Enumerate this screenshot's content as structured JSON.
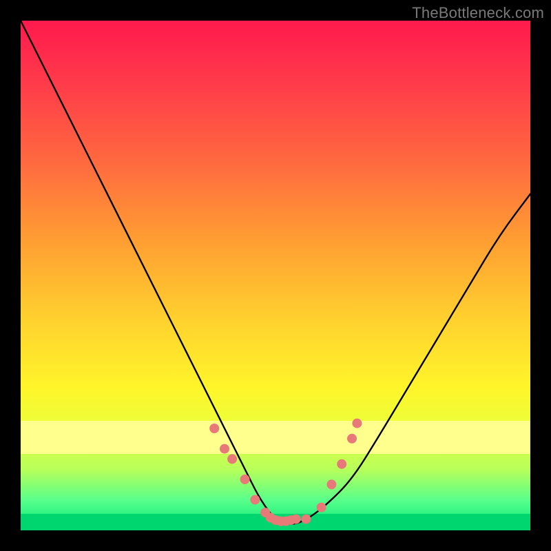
{
  "watermark": "TheBottleneck.com",
  "chart_data": {
    "type": "line",
    "title": "",
    "xlabel": "",
    "ylabel": "",
    "xlim": [
      0,
      100
    ],
    "ylim": [
      0,
      100
    ],
    "x": [
      0,
      6,
      12,
      18,
      24,
      30,
      36,
      40,
      44,
      47,
      50,
      53,
      56,
      60,
      65,
      70,
      76,
      82,
      88,
      94,
      100
    ],
    "values": [
      100,
      88,
      76,
      64,
      52,
      40,
      28,
      20,
      12,
      6,
      2,
      1,
      2,
      5,
      10,
      18,
      28,
      38,
      48,
      58,
      66
    ],
    "scatter_overlay": {
      "comment": "approximate coral/pink dot positions near the valley bottom (in 0-100 chart coords)",
      "x": [
        38,
        40,
        41.5,
        44,
        46,
        48,
        49,
        50,
        51,
        52,
        53,
        54,
        56,
        59,
        61,
        63,
        65,
        66
      ],
      "y": [
        20,
        16,
        14,
        10,
        6,
        3.5,
        2.5,
        2,
        1.8,
        1.8,
        2,
        2.2,
        2.2,
        4.5,
        9,
        13,
        18,
        21
      ],
      "color": "#e77a78",
      "radius_px": 7
    },
    "bands": [
      {
        "from_y": 15,
        "to_y": 21.5,
        "color": "#ffff8e"
      },
      {
        "from_y": 0,
        "to_y": 3.2,
        "color": "#00d66f"
      }
    ],
    "curve_color": "#000000",
    "background": "gradient-red-yellow-green"
  }
}
